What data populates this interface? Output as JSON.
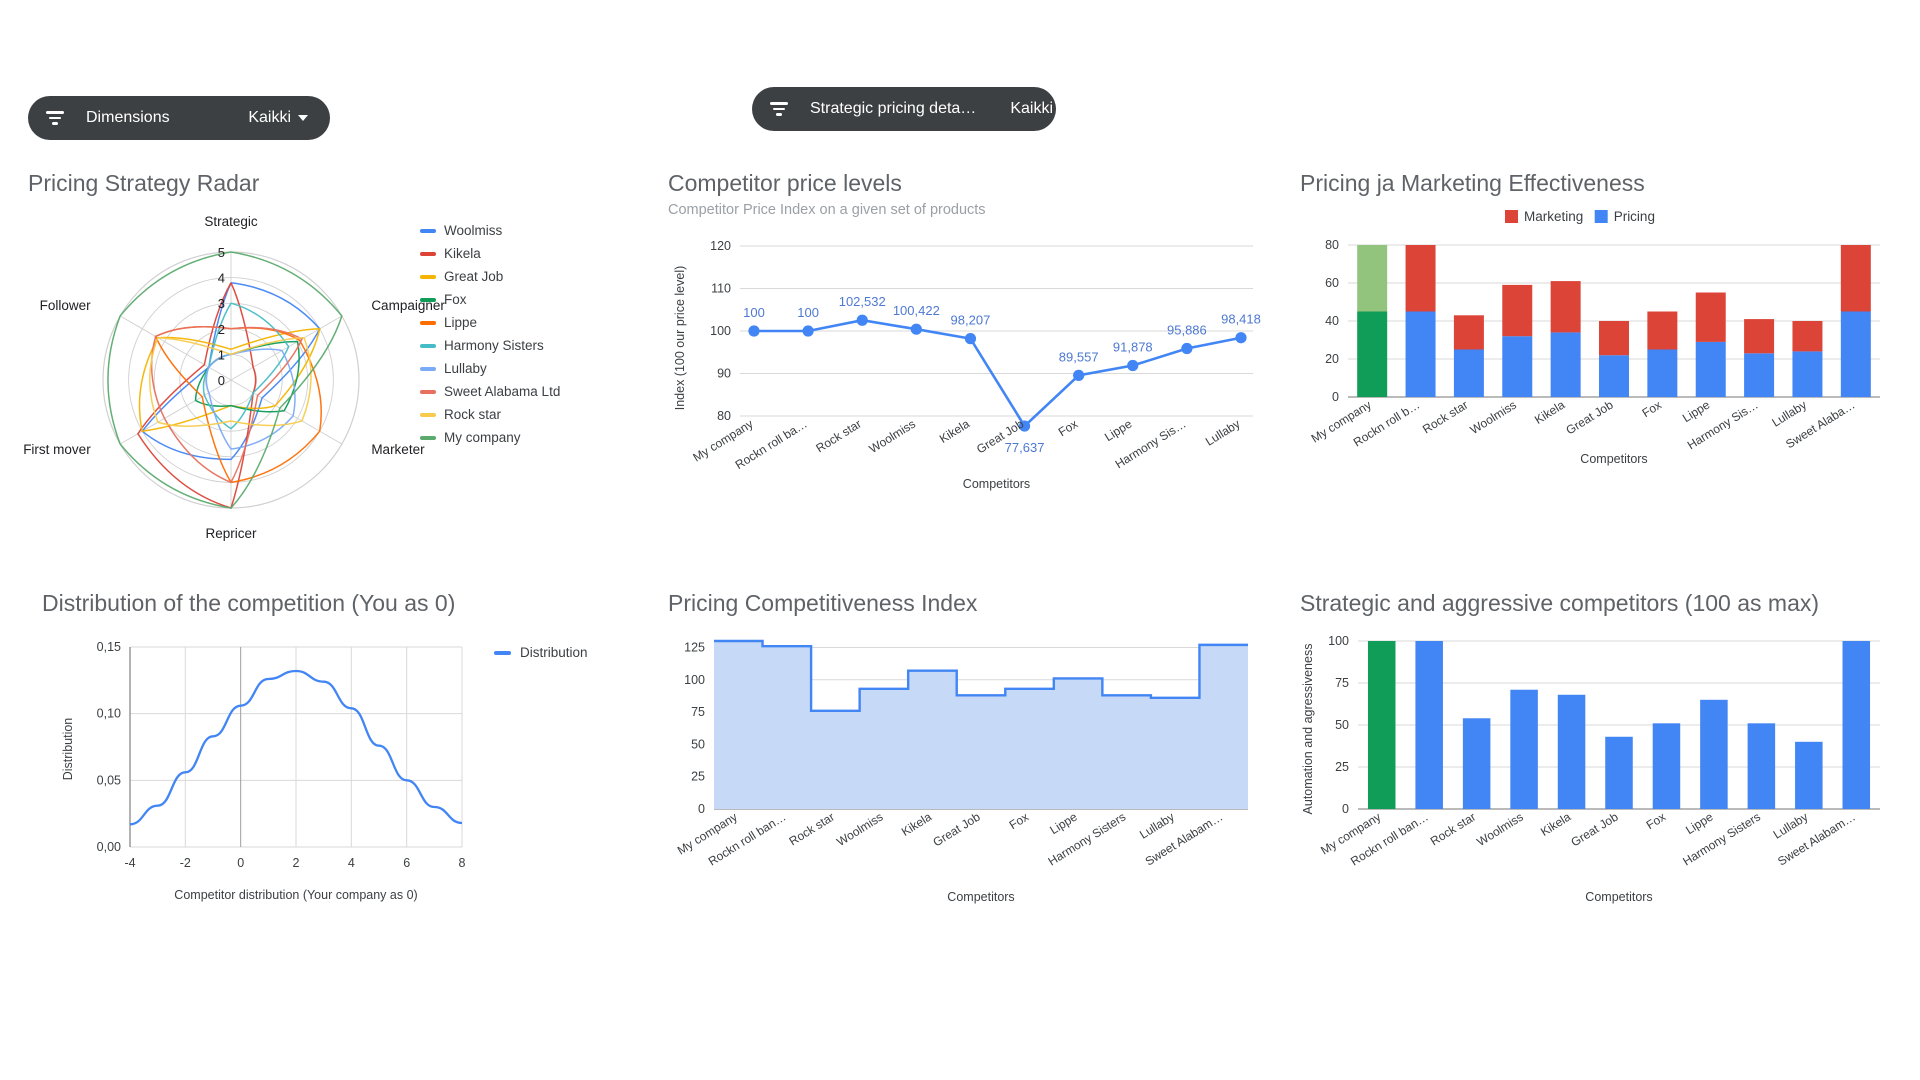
{
  "filters": [
    {
      "name": "dimensions",
      "icon": "filter-icon",
      "label": "Dimensions",
      "value": "Kaikki"
    },
    {
      "name": "strategic-pricing",
      "icon": "filter-icon",
      "label": "Strategic pricing deta…",
      "value": "Kaikki"
    }
  ],
  "colors": {
    "blue": "#4285f4",
    "red": "#db4437",
    "yellow": "#f4b400",
    "green": "#0f9d58",
    "light_green": "#93c47d",
    "orange": "#ff6d01",
    "teal": "#46bdc6",
    "light_blue": "#7baaf7",
    "salmon": "#e8705f",
    "light_yellow": "#f7cb4d",
    "mid_green": "#5bab6e",
    "area_fill": "#c6d9f7",
    "chip_bg": "#3c4043",
    "title_gray": "#5f6368",
    "sub_gray": "#9aa0a6"
  },
  "panels": {
    "radar": {
      "title": "Pricing Strategy Radar",
      "axes": [
        "Strategic",
        "Campaigner",
        "Marketer",
        "Repricer",
        "First mover",
        "Follower"
      ],
      "ticks": [
        "0",
        "1",
        "2",
        "3",
        "4",
        "5"
      ],
      "legend": [
        {
          "label": "Woolmiss",
          "color": "#4285f4"
        },
        {
          "label": "Kikela",
          "color": "#db4437"
        },
        {
          "label": "Great Job",
          "color": "#f4b400"
        },
        {
          "label": "Fox",
          "color": "#0f9d58"
        },
        {
          "label": "Lippe",
          "color": "#ff6d01"
        },
        {
          "label": "Harmony Sisters",
          "color": "#46bdc6"
        },
        {
          "label": "Lullaby",
          "color": "#7baaf7"
        },
        {
          "label": "Sweet Alabama Ltd",
          "color": "#e8705f"
        },
        {
          "label": "Rock star",
          "color": "#f7cb4d"
        },
        {
          "label": "My company",
          "color": "#5bab6e"
        }
      ]
    },
    "price_levels": {
      "title": "Competitor price levels",
      "subtitle": "Competitor Price Index on a given set of products"
    },
    "effectiveness": {
      "title": "Pricing ja Marketing Effectiveness",
      "legend": [
        {
          "label": "Marketing",
          "color": "#db4437"
        },
        {
          "label": "Pricing",
          "color": "#4285f4"
        }
      ]
    },
    "distribution": {
      "title": "Distribution of the competition (You as 0)",
      "legend": [
        {
          "label": "Distribution",
          "color": "#4285f4"
        }
      ]
    },
    "competitiveness": {
      "title": "Pricing Competitiveness Index"
    },
    "aggressive": {
      "title": "Strategic and aggressive competitors (100 as max)"
    }
  },
  "chart_data": [
    {
      "id": "radar",
      "type": "radar",
      "title": "Pricing Strategy Radar",
      "axes": [
        "Strategic",
        "Campaigner",
        "Marketer",
        "Repricer",
        "First mover",
        "Follower"
      ],
      "rlim": [
        0,
        5
      ],
      "tick_labels": [
        "0",
        "1",
        "2",
        "3",
        "4",
        "5"
      ],
      "legend_position": "right",
      "series": [
        {
          "name": "Woolmiss",
          "color": "#4285f4",
          "values": [
            3.8,
            4.0,
            1.4,
            3.1,
            4.0,
            1.0
          ]
        },
        {
          "name": "Kikela",
          "color": "#db4437",
          "values": [
            3.8,
            1.0,
            1.0,
            5.0,
            4.2,
            1.2
          ]
        },
        {
          "name": "Great Job",
          "color": "#f4b400",
          "values": [
            1.2,
            4.0,
            2.0,
            1.0,
            4.0,
            3.3
          ]
        },
        {
          "name": "Fox",
          "color": "#0f9d58",
          "values": [
            1.0,
            3.0,
            2.4,
            1.0,
            1.6,
            1.0
          ]
        },
        {
          "name": "Lippe",
          "color": "#ff6d01",
          "values": [
            2.0,
            3.1,
            4.0,
            4.0,
            1.3,
            3.4
          ]
        },
        {
          "name": "Harmony Sisters",
          "color": "#46bdc6",
          "values": [
            3.0,
            2.6,
            1.0,
            1.9,
            1.2,
            1.0
          ]
        },
        {
          "name": "Lullaby",
          "color": "#7baaf7",
          "values": [
            1.0,
            2.3,
            2.8,
            2.7,
            1.0,
            1.0
          ]
        },
        {
          "name": "Sweet Alabama Ltd",
          "color": "#e8705f",
          "values": [
            2.0,
            3.2,
            1.2,
            4.0,
            3.0,
            3.4
          ]
        },
        {
          "name": "Rock star",
          "color": "#f7cb4d",
          "values": [
            1.0,
            3.3,
            3.2,
            1.6,
            3.3,
            3.3
          ]
        },
        {
          "name": "My company",
          "color": "#5bab6e",
          "values": [
            5.0,
            5.0,
            2.2,
            5.0,
            5.0,
            5.0
          ]
        }
      ]
    },
    {
      "id": "price-levels",
      "type": "line",
      "title": "Competitor price levels",
      "subtitle": "Competitor Price Index on a given set of products",
      "xlabel": "Competitors",
      "ylabel": "Index (100 our price level)",
      "ylim": [
        80,
        120
      ],
      "yticks": [
        80,
        90,
        100,
        110,
        120
      ],
      "grid": true,
      "categories": [
        "My company",
        "Rockn roll ba…",
        "Rock star",
        "Woolmiss",
        "Kikela",
        "Great Job",
        "Fox",
        "Lippe",
        "Harmony Sis…",
        "Lullaby"
      ],
      "values": [
        100,
        100,
        102.532,
        100.422,
        98.207,
        77.637,
        89.557,
        91.878,
        95.886,
        98.418
      ],
      "point_labels": [
        "100",
        "100",
        "102,532",
        "100,422",
        "98,207",
        "77,637",
        "89,557",
        "91,878",
        "95,886",
        "98,418"
      ],
      "color": "#4285f4"
    },
    {
      "id": "effectiveness",
      "type": "bar",
      "stacked": true,
      "title": "Pricing ja Marketing Effectiveness",
      "xlabel": "Competitors",
      "ylim": [
        0,
        80
      ],
      "yticks": [
        0,
        20,
        40,
        60,
        80
      ],
      "grid": true,
      "legend_position": "top",
      "categories": [
        "My company",
        "Rockn roll b…",
        "Rock star",
        "Woolmiss",
        "Kikela",
        "Great Job",
        "Fox",
        "Lippe",
        "Harmony Sis…",
        "Lullaby",
        "Sweet Alaba…"
      ],
      "series": [
        {
          "name": "Pricing",
          "color": "#4285f4",
          "values": [
            45,
            45,
            25,
            32,
            34,
            22,
            25,
            29,
            23,
            24,
            45
          ]
        },
        {
          "name": "Marketing",
          "color": "#db4437",
          "values": [
            35,
            35,
            18,
            27,
            27,
            18,
            20,
            26,
            18,
            16,
            35
          ]
        }
      ],
      "highlight": {
        "index": 0,
        "base_color": "#0f9d58",
        "top_color": "#93c47d",
        "note": "My company bar drawn in green tones"
      }
    },
    {
      "id": "distribution",
      "type": "line",
      "title": "Distribution of the competition (You as 0)",
      "xlabel": "Competitor distribution (Your company as 0)",
      "ylabel": "Distribution",
      "xlim": [
        -4,
        8
      ],
      "xticks": [
        -4,
        -2,
        0,
        2,
        4,
        6,
        8
      ],
      "ylim": [
        0,
        0.15
      ],
      "yticks": [
        0,
        0.05,
        0.1,
        0.15
      ],
      "ytick_labels": [
        "0,00",
        "0,05",
        "0,10",
        "0,15"
      ],
      "grid": true,
      "legend": [
        "Distribution"
      ],
      "legend_position": "right",
      "color": "#4285f4",
      "x": [
        -4,
        -3,
        -2,
        -1,
        0,
        1,
        2,
        3,
        4,
        5,
        6,
        7,
        8
      ],
      "values": [
        0.017,
        0.031,
        0.056,
        0.083,
        0.106,
        0.126,
        0.132,
        0.124,
        0.104,
        0.076,
        0.05,
        0.03,
        0.018
      ]
    },
    {
      "id": "competitiveness",
      "type": "area",
      "stepped": true,
      "title": "Pricing Competitiveness Index",
      "xlabel": "Competitors",
      "ylim": [
        0,
        130
      ],
      "yticks": [
        0,
        25,
        50,
        75,
        100,
        125
      ],
      "grid": true,
      "color": "#4285f4",
      "fill": "#c6d9f7",
      "categories": [
        "My company",
        "Rockn roll ban…",
        "Rock star",
        "Woolmiss",
        "Kikela",
        "Great Job",
        "Fox",
        "Lippe",
        "Harmony Sisters",
        "Lullaby",
        "Sweet Alabam…"
      ],
      "values": [
        130,
        126,
        76,
        93,
        107,
        88,
        93,
        101,
        88,
        86,
        127
      ]
    },
    {
      "id": "aggressive",
      "type": "bar",
      "title": "Strategic and aggressive competitors (100 as max)",
      "xlabel": "Competitors",
      "ylabel": "Automation and agressiveness",
      "ylim": [
        0,
        100
      ],
      "yticks": [
        0,
        25,
        50,
        75,
        100
      ],
      "grid": true,
      "categories": [
        "My company",
        "Rockn roll ban…",
        "Rock star",
        "Woolmiss",
        "Kikela",
        "Great Job",
        "Fox",
        "Lippe",
        "Harmony Sisters",
        "Lullaby",
        "Sweet Alabam…"
      ],
      "values": [
        100,
        100,
        54,
        71,
        68,
        43,
        51,
        65,
        51,
        40,
        100
      ],
      "color": "#4285f4",
      "highlight": {
        "index": 0,
        "color": "#0f9d58"
      }
    }
  ]
}
